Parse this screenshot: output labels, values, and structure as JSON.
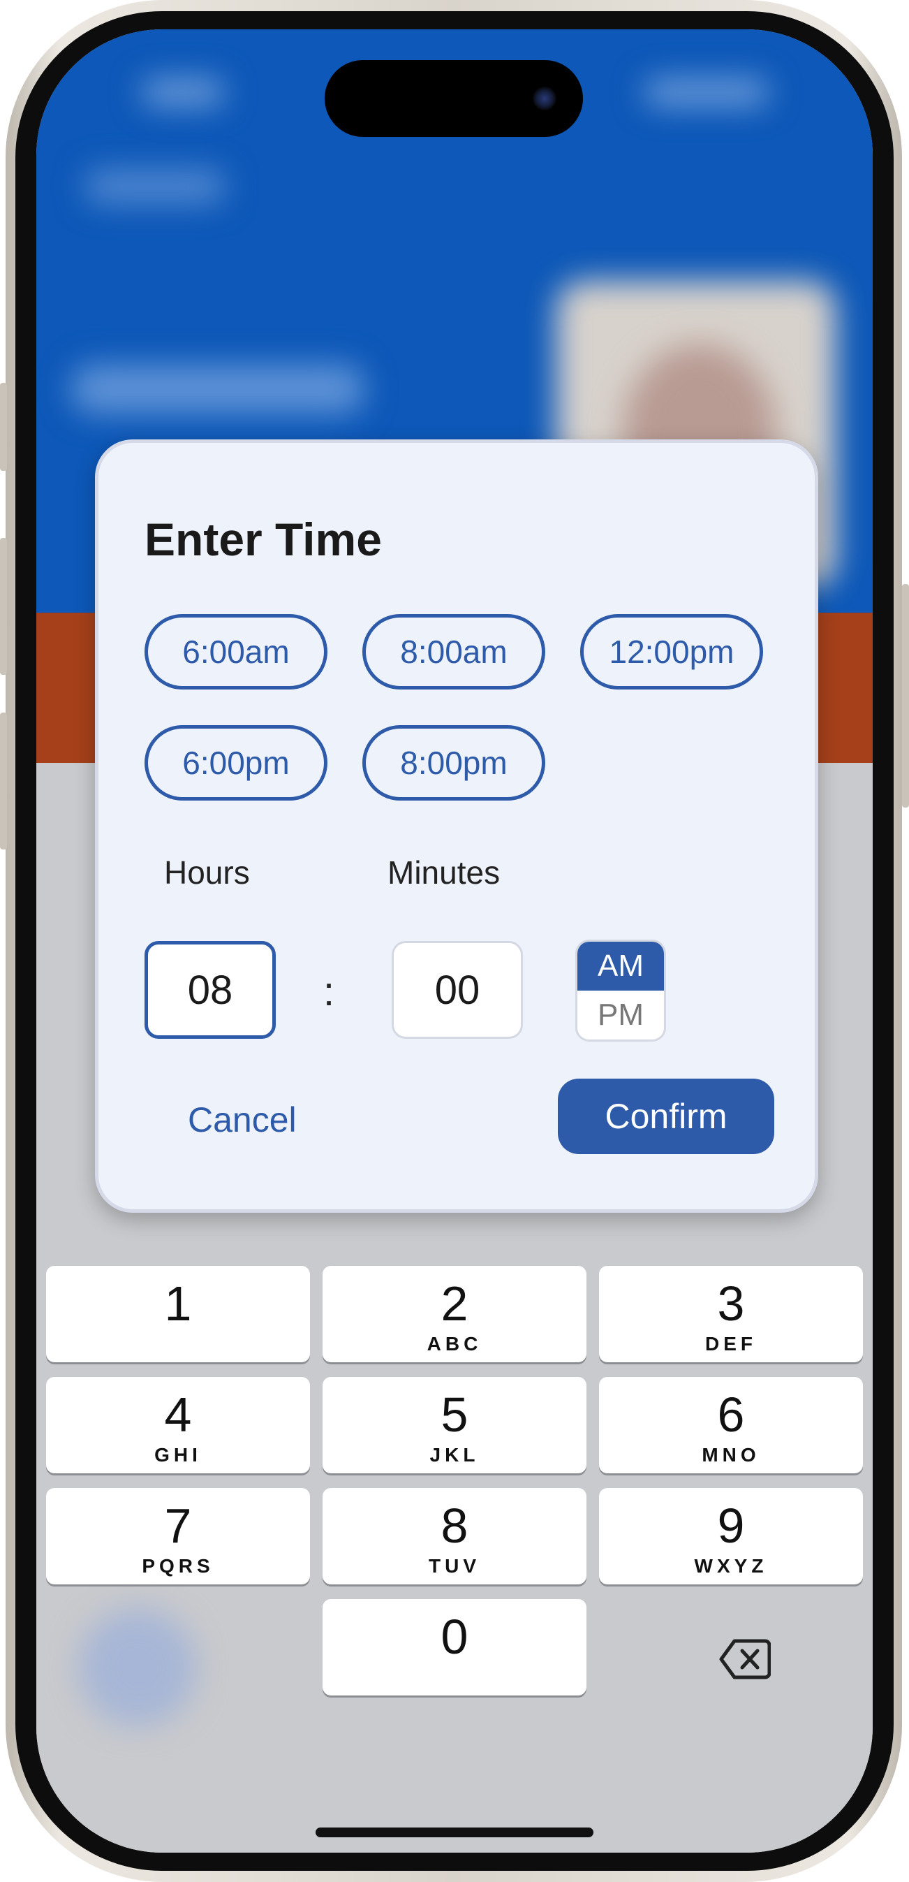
{
  "dialog": {
    "title": "Enter Time",
    "presets": [
      "6:00am",
      "8:00am",
      "12:00pm",
      "6:00pm",
      "8:00pm"
    ],
    "hours_label": "Hours",
    "minutes_label": "Minutes",
    "hours_value": "08",
    "separator": ":",
    "minutes_value": "00",
    "period_options": [
      "AM",
      "PM"
    ],
    "selected_period": "AM",
    "cancel_label": "Cancel",
    "confirm_label": "Confirm"
  },
  "keypad": {
    "keys": [
      {
        "digit": "1",
        "letters": ""
      },
      {
        "digit": "2",
        "letters": "ABC"
      },
      {
        "digit": "3",
        "letters": "DEF"
      },
      {
        "digit": "4",
        "letters": "GHI"
      },
      {
        "digit": "5",
        "letters": "JKL"
      },
      {
        "digit": "6",
        "letters": "MNO"
      },
      {
        "digit": "7",
        "letters": "PQRS"
      },
      {
        "digit": "8",
        "letters": "TUV"
      },
      {
        "digit": "9",
        "letters": "WXYZ"
      },
      {
        "digit": "0",
        "letters": ""
      }
    ],
    "backspace_icon": "delete-left-icon"
  },
  "colors": {
    "accent": "#2d5aa9",
    "dialog_background": "#eef2fb",
    "background_blue": "#0d58b8",
    "background_orange": "#a5401a"
  }
}
